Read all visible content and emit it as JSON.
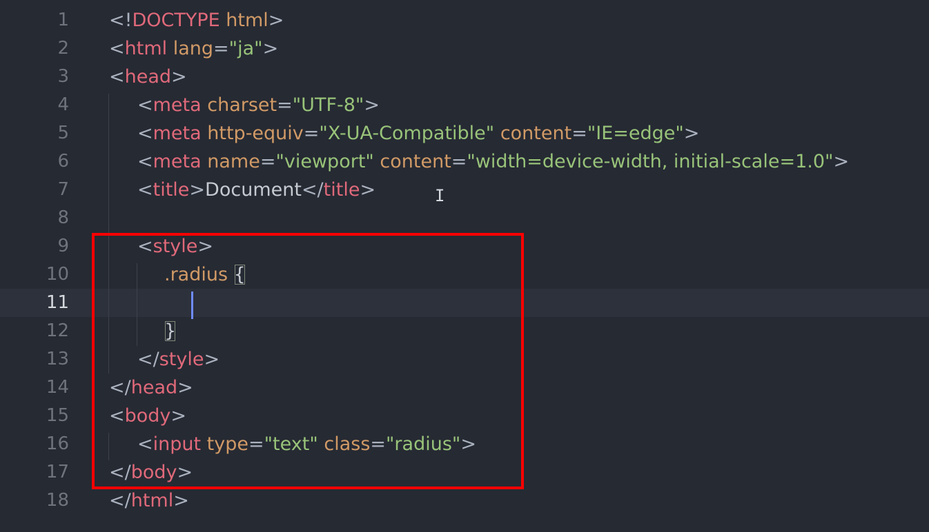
{
  "top_strip": [
    "'",
    "'",
    "'",
    "'",
    "'",
    "'"
  ],
  "lines": [
    {
      "num": "1",
      "segments": [
        [
          "p",
          "<!"
        ],
        [
          "t",
          "DOCTYPE"
        ],
        [
          "tx",
          " "
        ],
        [
          "a",
          "html"
        ],
        [
          "p",
          ">"
        ]
      ]
    },
    {
      "num": "2",
      "segments": [
        [
          "p",
          "<"
        ],
        [
          "t",
          "html"
        ],
        [
          "tx",
          " "
        ],
        [
          "a",
          "lang"
        ],
        [
          "p",
          "="
        ],
        [
          "s",
          "\"ja\""
        ],
        [
          "p",
          ">"
        ]
      ]
    },
    {
      "num": "3",
      "segments": [
        [
          "p",
          "<"
        ],
        [
          "t",
          "head"
        ],
        [
          "p",
          ">"
        ]
      ]
    },
    {
      "num": "4",
      "segments": [
        [
          "p",
          "<"
        ],
        [
          "t",
          "meta"
        ],
        [
          "tx",
          " "
        ],
        [
          "a",
          "charset"
        ],
        [
          "p",
          "="
        ],
        [
          "s",
          "\"UTF-8\""
        ],
        [
          "p",
          ">"
        ]
      ]
    },
    {
      "num": "5",
      "segments": [
        [
          "p",
          "<"
        ],
        [
          "t",
          "meta"
        ],
        [
          "tx",
          " "
        ],
        [
          "a",
          "http-equiv"
        ],
        [
          "p",
          "="
        ],
        [
          "s",
          "\"X-UA-Compatible\""
        ],
        [
          "tx",
          " "
        ],
        [
          "a",
          "content"
        ],
        [
          "p",
          "="
        ],
        [
          "s",
          "\"IE=edge\""
        ],
        [
          "p",
          ">"
        ]
      ]
    },
    {
      "num": "6",
      "segments": [
        [
          "p",
          "<"
        ],
        [
          "t",
          "meta"
        ],
        [
          "tx",
          " "
        ],
        [
          "a",
          "name"
        ],
        [
          "p",
          "="
        ],
        [
          "s",
          "\"viewport\""
        ],
        [
          "tx",
          " "
        ],
        [
          "a",
          "content"
        ],
        [
          "p",
          "="
        ],
        [
          "s",
          "\"width=device-width, initial-scale=1.0\""
        ],
        [
          "p",
          ">"
        ]
      ]
    },
    {
      "num": "7",
      "segments": [
        [
          "p",
          "<"
        ],
        [
          "t",
          "title"
        ],
        [
          "p",
          ">"
        ],
        [
          "tx",
          "Document"
        ],
        [
          "p",
          "</"
        ],
        [
          "t",
          "title"
        ],
        [
          "p",
          ">"
        ]
      ]
    },
    {
      "num": "8",
      "segments": []
    },
    {
      "num": "9",
      "segments": [
        [
          "p",
          "<"
        ],
        [
          "t",
          "style"
        ],
        [
          "p",
          ">"
        ]
      ]
    },
    {
      "num": "10",
      "segments": [
        [
          "cls",
          ".radius"
        ],
        [
          "tx",
          " "
        ],
        [
          "br",
          "{"
        ]
      ]
    },
    {
      "num": "11",
      "segments": []
    },
    {
      "num": "12",
      "segments": [
        [
          "br",
          "}"
        ]
      ]
    },
    {
      "num": "13",
      "segments": [
        [
          "p",
          "</"
        ],
        [
          "t",
          "style"
        ],
        [
          "p",
          ">"
        ]
      ]
    },
    {
      "num": "14",
      "segments": [
        [
          "p",
          "</"
        ],
        [
          "t",
          "head"
        ],
        [
          "p",
          ">"
        ]
      ]
    },
    {
      "num": "15",
      "segments": [
        [
          "p",
          "<"
        ],
        [
          "t",
          "body"
        ],
        [
          "p",
          ">"
        ]
      ]
    },
    {
      "num": "16",
      "segments": [
        [
          "p",
          "<"
        ],
        [
          "t",
          "input"
        ],
        [
          "tx",
          " "
        ],
        [
          "a",
          "type"
        ],
        [
          "p",
          "="
        ],
        [
          "s",
          "\"text\""
        ],
        [
          "tx",
          " "
        ],
        [
          "a",
          "class"
        ],
        [
          "p",
          "="
        ],
        [
          "s",
          "\"radius\""
        ],
        [
          "p",
          ">"
        ]
      ]
    },
    {
      "num": "17",
      "segments": [
        [
          "p",
          "</"
        ],
        [
          "t",
          "body"
        ],
        [
          "p",
          ">"
        ]
      ]
    },
    {
      "num": "18",
      "segments": [
        [
          "p",
          "</"
        ],
        [
          "t",
          "html"
        ],
        [
          "p",
          ">"
        ]
      ]
    }
  ],
  "active_line": "11",
  "colors": {
    "background": "#262a33",
    "tag": "#e0697a",
    "attribute": "#d19a66",
    "string": "#98c379",
    "punctuation": "#abb2bf",
    "highlight_box": "#ff0000",
    "cursor": "#6f8cff"
  },
  "icons": {
    "text_cursor": "I"
  }
}
